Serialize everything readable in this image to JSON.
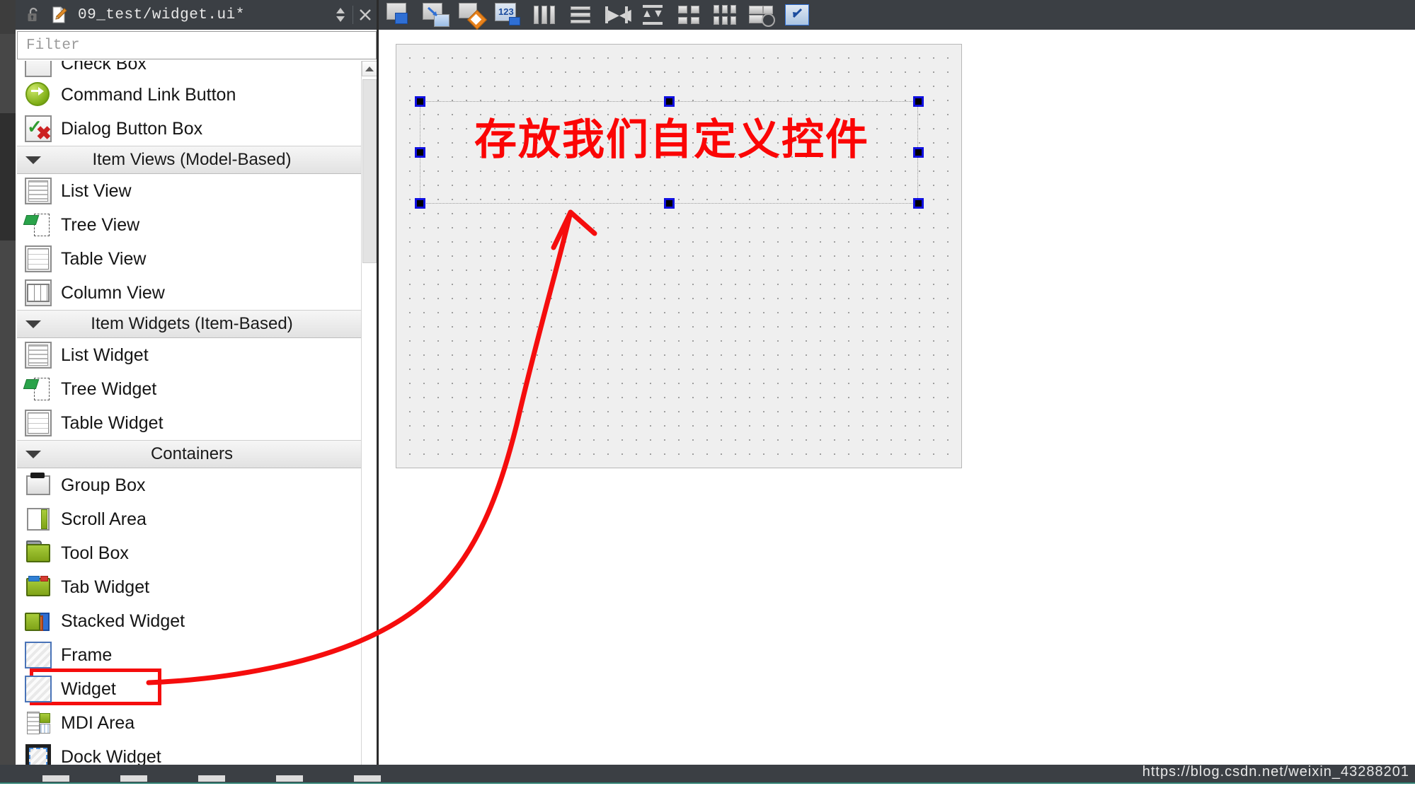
{
  "window": {
    "dock_title": "09_test/widget.ui*",
    "lock_icon": "unlock-icon",
    "doc_icon": "document-edit-icon",
    "float_button": "float-dock-icon",
    "close_button": "close-dock-icon"
  },
  "search": {
    "placeholder": "Filter",
    "value": ""
  },
  "toolbar": {
    "items": [
      {
        "name": "edit-widgets",
        "label": "Edit Widgets"
      },
      {
        "name": "edit-signals-slots",
        "label": "Edit Signals/Slots"
      },
      {
        "name": "edit-buddies",
        "label": "Edit Buddies"
      },
      {
        "name": "edit-tab-order",
        "label": "Edit Tab Order"
      },
      {
        "name": "layout-horizontally",
        "label": "Lay Out Horizontally"
      },
      {
        "name": "layout-vertically",
        "label": "Lay Out Vertically"
      },
      {
        "name": "layout-splitter-horizontal",
        "label": "Lay Out Horizontally in Splitter"
      },
      {
        "name": "layout-splitter-vertical",
        "label": "Lay Out Vertically in Splitter"
      },
      {
        "name": "layout-form",
        "label": "Lay Out in a Form Layout"
      },
      {
        "name": "layout-grid",
        "label": "Lay Out in a Grid"
      },
      {
        "name": "break-layout",
        "label": "Break Layout"
      },
      {
        "name": "adjust-size",
        "label": "Adjust Size"
      }
    ]
  },
  "widget_box": {
    "groups": [
      {
        "header": null,
        "items": [
          {
            "label": "Check Box",
            "icon": "check-box-icon",
            "clipped": true
          }
        ]
      },
      {
        "header": null,
        "items": [
          {
            "label": "Command Link Button",
            "icon": "command-link-button-icon"
          },
          {
            "label": "Dialog Button Box",
            "icon": "dialog-button-box-icon"
          }
        ]
      },
      {
        "header": "Item Views (Model-Based)",
        "items": [
          {
            "label": "List View",
            "icon": "list-view-icon"
          },
          {
            "label": "Tree View",
            "icon": "tree-view-icon"
          },
          {
            "label": "Table View",
            "icon": "table-view-icon"
          },
          {
            "label": "Column View",
            "icon": "column-view-icon"
          }
        ]
      },
      {
        "header": "Item Widgets (Item-Based)",
        "items": [
          {
            "label": "List Widget",
            "icon": "list-widget-icon"
          },
          {
            "label": "Tree Widget",
            "icon": "tree-widget-icon"
          },
          {
            "label": "Table Widget",
            "icon": "table-widget-icon"
          }
        ]
      },
      {
        "header": "Containers",
        "items": [
          {
            "label": "Group Box",
            "icon": "group-box-icon"
          },
          {
            "label": "Scroll Area",
            "icon": "scroll-area-icon"
          },
          {
            "label": "Tool Box",
            "icon": "tool-box-icon"
          },
          {
            "label": "Tab Widget",
            "icon": "tab-widget-icon"
          },
          {
            "label": "Stacked Widget",
            "icon": "stacked-widget-icon"
          },
          {
            "label": "Frame",
            "icon": "frame-icon"
          },
          {
            "label": "Widget",
            "icon": "widget-icon",
            "highlighted": true
          },
          {
            "label": "MDI Area",
            "icon": "mdi-area-icon"
          },
          {
            "label": "Dock Widget",
            "icon": "dock-widget-icon"
          }
        ]
      }
    ]
  },
  "canvas": {
    "label_text": "存放我们自定义控件",
    "label_color": "#fb0505",
    "selected": true,
    "handle_count": 8
  },
  "annotation": {
    "highlight_color": "#f50d0d",
    "arrow_color": "#f50d0d",
    "target": "Widget"
  },
  "watermark": "https://blog.csdn.net/weixin_43288201"
}
